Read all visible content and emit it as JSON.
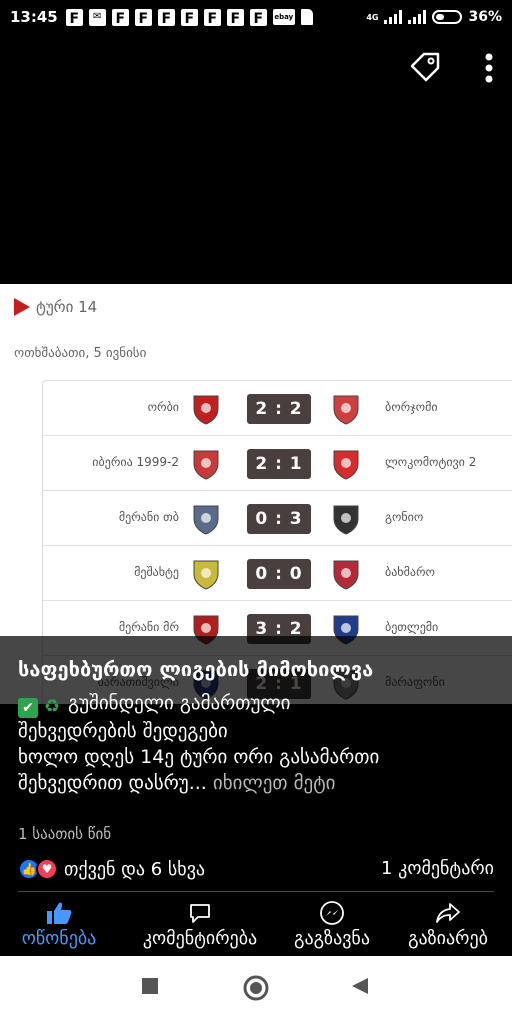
{
  "status_bar": {
    "time": "13:45",
    "notification_icons": [
      "F",
      "F",
      "F",
      "F",
      "F",
      "F",
      "F",
      "F",
      "F"
    ],
    "ebay_label": "ebay",
    "network": "4G",
    "battery_percent": "36%",
    "battery_level": 0.36
  },
  "toolbar": {
    "tag_icon": "tag-icon",
    "menu_icon": "more-vertical-icon"
  },
  "image": {
    "round_title": "ტური 14",
    "date": "ოთხშაბათი, 5 ივნისი",
    "matches": [
      {
        "home": "ორბი",
        "score": "2 : 2",
        "away": "ბორჯომი",
        "home_color": "#c02020",
        "away_color": "#d04040"
      },
      {
        "home": "იბერია 1999-2",
        "score": "2 : 1",
        "away": "ლოკომოტივი 2",
        "home_color": "#c83a3a",
        "away_color": "#d62c2c"
      },
      {
        "home": "მერანი თბ",
        "score": "0 : 3",
        "away": "გონიო",
        "home_color": "#5a6b8a",
        "away_color": "#333333"
      },
      {
        "home": "მეშახტე",
        "score": "0 : 0",
        "away": "ბახმარო",
        "home_color": "#c9b93a",
        "away_color": "#b52a3a"
      },
      {
        "home": "მერანი მრ",
        "score": "3 : 2",
        "away": "ბეთლემი",
        "home_color": "#b01e1e",
        "away_color": "#1f3d8a"
      },
      {
        "home": "ბარათიშვილი",
        "score": "2 : 1",
        "away": "მარაფონი",
        "home_color": "#1f3d8a",
        "away_color": "#888888"
      }
    ]
  },
  "post": {
    "title": "საფეხბურთო ლიგების მიმოხილვა",
    "line1": "გუშინდელი გამართული",
    "line2": "შეხვედრების შედეგები",
    "line3": "ხოლო დღეს 14ე ტური ორი გასამართი",
    "line4_text": "შეხვედრით დასრუ...",
    "see_more": "იხილეთ მეტი",
    "time_ago": "1 საათის წინ"
  },
  "reactions": {
    "summary": "თქვენ და 6 სხვა",
    "comments": "1 კომენტარი"
  },
  "actions": {
    "like": "ოწონება",
    "comment": "კომენტირება",
    "send": "გაგზავნა",
    "share": "გაზიარებ"
  },
  "colors": {
    "like_blue": "#4599ff",
    "score_bg": "#4a3f3f",
    "round_red": "#c41e1e"
  }
}
